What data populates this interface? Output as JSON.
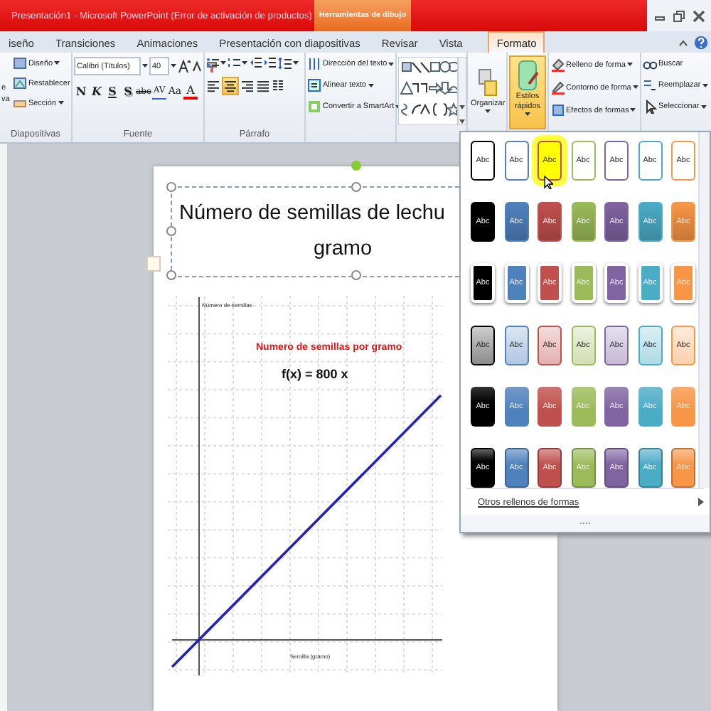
{
  "window": {
    "title": "Presentación1 - Microsoft PowerPoint (Error de activación de productos)",
    "context_tab": "Herramientas de dibujo"
  },
  "tabs": [
    {
      "label": "iseño",
      "selected": false
    },
    {
      "label": "Transiciones",
      "selected": false
    },
    {
      "label": "Animaciones",
      "selected": false
    },
    {
      "label": "Presentación con diapositivas",
      "selected": false
    },
    {
      "label": "Revisar",
      "selected": false
    },
    {
      "label": "Vista",
      "selected": false
    },
    {
      "label": "Formato",
      "selected": true
    }
  ],
  "ribbon": {
    "slides": {
      "partial_button": [
        "e",
        "va"
      ],
      "buttons": [
        "Diseño",
        "Restablecer",
        "Sección"
      ],
      "label": "Diapositivas"
    },
    "font": {
      "name": "Calibri (Títulos)",
      "size": "40",
      "label": "Fuente",
      "format_buttons": [
        {
          "kind": "bold",
          "text": "N"
        },
        {
          "kind": "italic",
          "text": "K"
        },
        {
          "kind": "underline",
          "text": "S"
        },
        {
          "kind": "shadow",
          "text": "S"
        },
        {
          "kind": "strike",
          "text": "abc"
        },
        {
          "kind": "spacing",
          "text": "AV"
        },
        {
          "kind": "case",
          "text": "Aa"
        },
        {
          "kind": "color",
          "text": "A"
        }
      ]
    },
    "paragraph": {
      "label": "Párrafo",
      "align": [
        {
          "selected": false
        },
        {
          "selected": true
        },
        {
          "selected": false
        },
        {
          "selected": false
        }
      ]
    },
    "text": [
      "Dirección del texto",
      "Alinear texto",
      "Convertir a SmartArt"
    ],
    "arrange": "Organizar",
    "quick_styles": {
      "label": "Estilos rápidos",
      "selected": true
    },
    "shape_format": [
      "Relleno de forma",
      "Contorno de forma",
      "Efectos de formas"
    ],
    "editing": [
      "Buscar",
      "Reemplazar",
      "Seleccionar"
    ]
  },
  "slide": {
    "title_lines": [
      "Número de semillas de lechu",
      "gramo"
    ],
    "graph": {
      "y_title": "Número de semillas",
      "title": "Numero de semillas por gramo",
      "formula": "f(x) = 800 x",
      "x_title": "Semilla (gramo)"
    }
  },
  "gallery": {
    "rows": [
      {
        "kind": "outline",
        "swatches": [
          {
            "label": "Abc",
            "color": "#000000",
            "selected": false
          },
          {
            "label": "Abc",
            "color": "#4f81bd",
            "selected": false
          },
          {
            "label": "Abc",
            "color": "#c0504d",
            "selected": true
          },
          {
            "label": "Abc",
            "color": "#9bbb59",
            "selected": false
          },
          {
            "label": "Abc",
            "color": "#8064a2",
            "selected": false
          },
          {
            "label": "Abc",
            "color": "#4bacc6",
            "selected": false
          },
          {
            "label": "Abc",
            "color": "#f79646",
            "selected": false
          }
        ]
      },
      {
        "kind": "dark",
        "swatches": [
          {
            "label": "Abc",
            "color": "#000000",
            "selected": false
          },
          {
            "label": "Abc",
            "color": "#4f81bd",
            "selected": false
          },
          {
            "label": "Abc",
            "color": "#c0504d",
            "selected": false
          },
          {
            "label": "Abc",
            "color": "#9bbb59",
            "selected": false
          },
          {
            "label": "Abc",
            "color": "#8064a2",
            "selected": false
          },
          {
            "label": "Abc",
            "color": "#4bacc6",
            "selected": false
          },
          {
            "label": "Abc",
            "color": "#f79646",
            "selected": false
          }
        ]
      },
      {
        "kind": "raised",
        "swatches": [
          {
            "label": "Abc",
            "color": "#000000",
            "selected": false
          },
          {
            "label": "Abc",
            "color": "#4f81bd",
            "selected": false
          },
          {
            "label": "Abc",
            "color": "#c0504d",
            "selected": false
          },
          {
            "label": "Abc",
            "color": "#9bbb59",
            "selected": false
          },
          {
            "label": "Abc",
            "color": "#8064a2",
            "selected": false
          },
          {
            "label": "Abc",
            "color": "#4bacc6",
            "selected": false
          },
          {
            "label": "Abc",
            "color": "#f79646",
            "selected": false
          }
        ]
      },
      {
        "kind": "light",
        "swatches": [
          {
            "label": "Abc",
            "color": "#000000",
            "selected": false
          },
          {
            "label": "Abc",
            "color": "#4f81bd",
            "selected": false
          },
          {
            "label": "Abc",
            "color": "#c0504d",
            "selected": false
          },
          {
            "label": "Abc",
            "color": "#9bbb59",
            "selected": false
          },
          {
            "label": "Abc",
            "color": "#8064a2",
            "selected": false
          },
          {
            "label": "Abc",
            "color": "#4bacc6",
            "selected": false
          },
          {
            "label": "Abc",
            "color": "#f79646",
            "selected": false
          }
        ]
      },
      {
        "kind": "gradient",
        "swatches": [
          {
            "label": "Abc",
            "color": "#000000",
            "selected": false
          },
          {
            "label": "Abc",
            "color": "#4f81bd",
            "selected": false
          },
          {
            "label": "Abc",
            "color": "#c0504d",
            "selected": false
          },
          {
            "label": "Abc",
            "color": "#9bbb59",
            "selected": false
          },
          {
            "label": "Abc",
            "color": "#8064a2",
            "selected": false
          },
          {
            "label": "Abc",
            "color": "#4bacc6",
            "selected": false
          },
          {
            "label": "Abc",
            "color": "#f79646",
            "selected": false
          }
        ]
      },
      {
        "kind": "bright",
        "swatches": [
          {
            "label": "Abc",
            "color": "#000000",
            "selected": false
          },
          {
            "label": "Abc",
            "color": "#4f81bd",
            "selected": false
          },
          {
            "label": "Abc",
            "color": "#c0504d",
            "selected": false
          },
          {
            "label": "Abc",
            "color": "#9bbb59",
            "selected": false
          },
          {
            "label": "Abc",
            "color": "#8064a2",
            "selected": false
          },
          {
            "label": "Abc",
            "color": "#4bacc6",
            "selected": false
          },
          {
            "label": "Abc",
            "color": "#f79646",
            "selected": false
          }
        ]
      }
    ],
    "footer": "Otros rellenos de formas"
  }
}
